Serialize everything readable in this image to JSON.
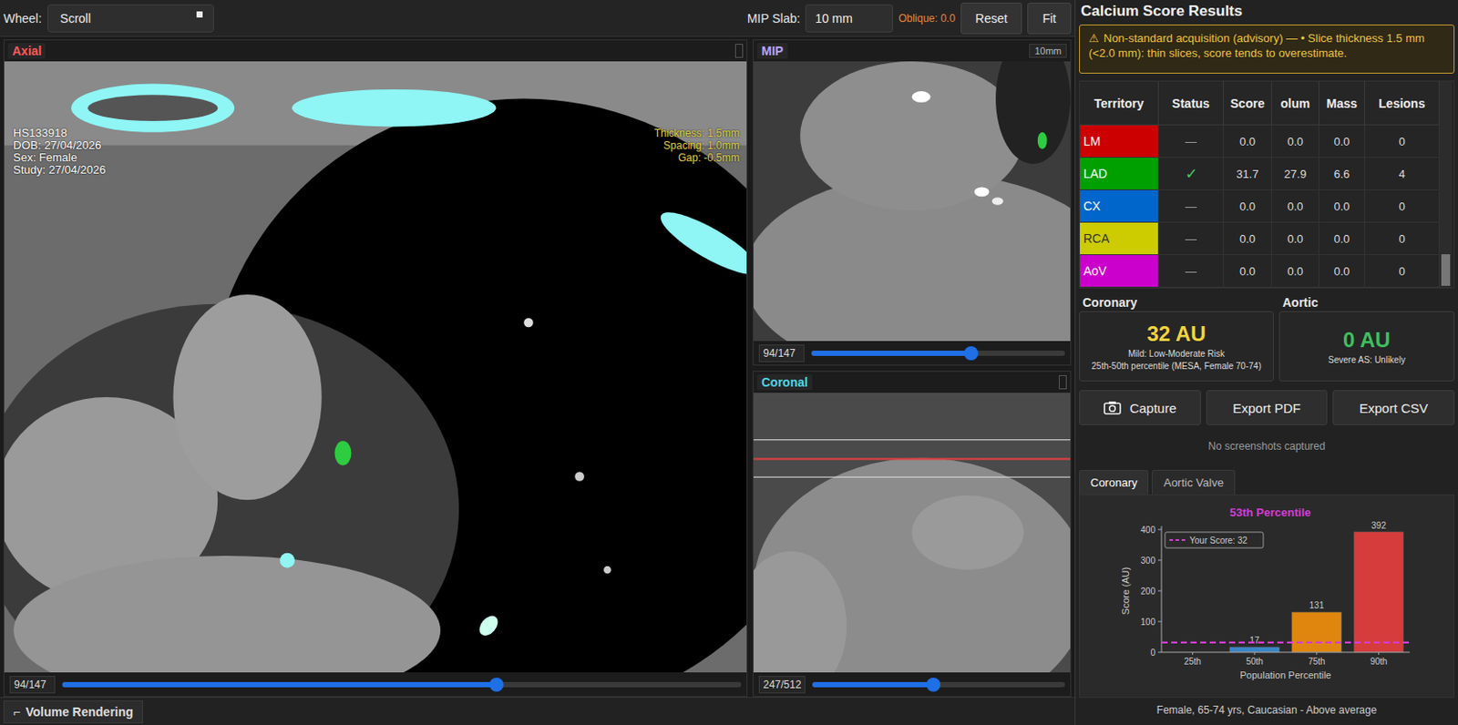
{
  "toolbar": {
    "wheel_label": "Wheel:",
    "wheel_value": "Scroll",
    "mip_label": "MIP Slab:",
    "mip_value": "10 mm",
    "oblique": "Oblique: 0.0",
    "buttons": [
      "Reset",
      "Fit"
    ]
  },
  "views": {
    "axial": {
      "title": "Axial",
      "color": "#ff5a5a",
      "slice": "94/147",
      "level": 0.64,
      "patient": [
        "HS133918",
        "DOB: 27/04/2026",
        "Sex: Female",
        "Study: 27/04/2026"
      ],
      "acquisition": [
        "Thickness: 1.5mm",
        "Spacing: 1.0mm",
        "Gap: -0.5mm"
      ]
    },
    "mip": {
      "title": "MIP",
      "color": "#b8a4ff",
      "badge": "10mm",
      "slice": "94/147",
      "level": 0.63
    },
    "coronal": {
      "title": "Coronal",
      "color": "#4fd6e6",
      "slice": "247/512",
      "level": 0.48
    }
  },
  "volume_rendering": {
    "icon": "⌐",
    "label": "Volume Rendering"
  },
  "results": {
    "title": "Calcium Score Results",
    "warning": {
      "icon": "⚠",
      "text": "Non-standard acquisition (advisory) — • Slice thickness 1.5 mm (<2.0 mm): thin slices, score tends to overestimate."
    },
    "table": {
      "columns": [
        "Territory",
        "Status",
        "Score",
        "olum",
        "Mass",
        "Lesions"
      ],
      "rows": [
        {
          "territory": "LM",
          "color": "#cc0000",
          "status": "—",
          "detected": false,
          "score": "0.0",
          "volume": "0.0",
          "mass": "0.0",
          "lesions": "0"
        },
        {
          "territory": "LAD",
          "color": "#00a000",
          "status": "✓",
          "detected": true,
          "score": "31.7",
          "volume": "27.9",
          "mass": "6.6",
          "lesions": "4"
        },
        {
          "territory": "CX",
          "color": "#0066cc",
          "status": "—",
          "detected": false,
          "score": "0.0",
          "volume": "0.0",
          "mass": "0.0",
          "lesions": "0"
        },
        {
          "territory": "RCA",
          "color": "#cccc00",
          "status": "—",
          "detected": false,
          "score": "0.0",
          "volume": "0.0",
          "mass": "0.0",
          "lesions": "0"
        },
        {
          "territory": "AoV",
          "color": "#cc00cc",
          "status": "—",
          "detected": false,
          "score": "0.0",
          "volume": "0.0",
          "mass": "0.0",
          "lesions": "0"
        }
      ]
    },
    "coronary": {
      "title": "Coronary",
      "value": "32 AU",
      "color": "#f2d43c",
      "risk": "Mild: Low-Moderate Risk",
      "percentile": "25th-50th percentile (MESA, Female 70-74)"
    },
    "aortic": {
      "title": "Aortic",
      "value": "0 AU",
      "color": "#3fbf5f",
      "note": "Severe AS: Unlikely"
    },
    "actions": [
      "Capture",
      "Export PDF",
      "Export CSV"
    ],
    "screenshots_note": "No screenshots captured",
    "tabs": [
      {
        "label": "Coronary",
        "selected": true
      },
      {
        "label": "Aortic Valve",
        "selected": false
      }
    ],
    "chart": {
      "title": "53th Percentile",
      "y_label": "Score (AU)",
      "x_label": "Population Percentile",
      "y_ticks": [
        "0",
        "100",
        "200",
        "300",
        "400"
      ],
      "legend": "Your Score: 32",
      "score": 32,
      "bars": [
        {
          "category": "25th",
          "value": 0,
          "color": "#3a86c8"
        },
        {
          "category": "50th",
          "value": 17,
          "label": "17",
          "color": "#3a86c8"
        },
        {
          "category": "75th",
          "value": 131,
          "label": "131",
          "color": "#e0860f"
        },
        {
          "category": "90th",
          "value": 392,
          "label": "392",
          "color": "#d63c3c"
        }
      ]
    },
    "footer": "Female, 65-74 yrs, Caucasian - Above average"
  }
}
